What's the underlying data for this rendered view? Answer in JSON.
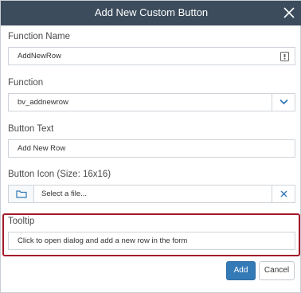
{
  "dialog": {
    "title": "Add New Custom Button"
  },
  "function_name": {
    "label": "Function Name",
    "value": "AddNewRow"
  },
  "function": {
    "label": "Function",
    "selected": "bv_addnewrow"
  },
  "button_text": {
    "label": "Button Text",
    "value": "Add New Row"
  },
  "button_icon": {
    "label": "Button Icon (Size: 16x16)",
    "placeholder": "Select a file..."
  },
  "tooltip": {
    "label": "Tooltip",
    "value": "Click to open dialog and add a new row in the form"
  },
  "actions": {
    "add_label": "Add",
    "cancel_label": "Cancel"
  },
  "colors": {
    "titlebar": "#3c4c5c",
    "primary": "#337ab7",
    "highlight": "#a3192b"
  },
  "icons": [
    "close-icon",
    "lock-icon",
    "chevron-down-icon",
    "folder-icon",
    "clear-icon"
  ]
}
